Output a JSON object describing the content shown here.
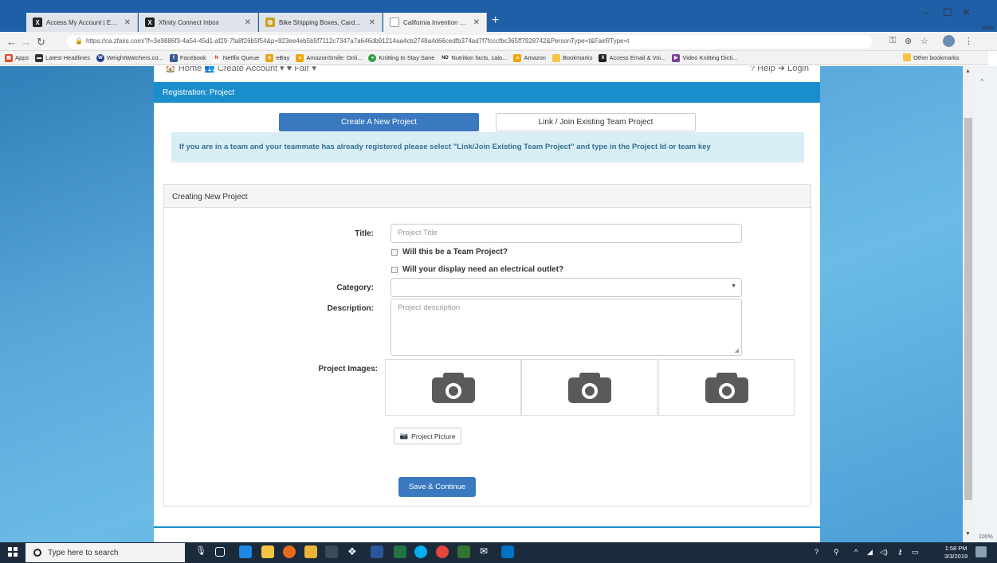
{
  "browser": {
    "tabs": [
      {
        "title": "Access My Account | Email | Onl",
        "favicon": "x-square-icon",
        "color": "#222"
      },
      {
        "title": "Xfinity Connect Inbox",
        "favicon": "x-square-icon",
        "color": "#222"
      },
      {
        "title": "Bike Shipping Boxes, Cardboard",
        "favicon": "bike-icon",
        "color": "#c9a227"
      },
      {
        "title": "California Invention Convention",
        "favicon": "page-icon",
        "color": "#999",
        "active": true
      }
    ],
    "new_tab": "+",
    "window_controls": {
      "minimize": "–",
      "maximize": "☐",
      "close": "✕"
    },
    "url": "https://ca.zfairs.com/?f=3e9886f3-4a54-45d1-af29-7fa8f26b5f54&p=923ee4eb5b5f7112c7347a7a646db91214aa4cb2748a4d66cedfb374ad7f7fcccfbc365ff7928742&PersonType=t&FairRType=t",
    "bookmarks": [
      {
        "label": "Apps",
        "color": "#e04b2a"
      },
      {
        "label": "Latest Headlines",
        "color": "#333"
      },
      {
        "label": "WeightWatchers.co...",
        "color": "#1e3c8a"
      },
      {
        "label": "Facebook",
        "color": "#3b5998"
      },
      {
        "label": "Netflix Queue",
        "color": "#d11"
      },
      {
        "label": "eBay",
        "color": "#e8a31b"
      },
      {
        "label": "AmazonSmile: Onli...",
        "color": "#f0a500"
      },
      {
        "label": "Knitting to Stay Sane",
        "color": "#2f9e44"
      },
      {
        "label": "Nutrition facts, calo...",
        "color": "#111"
      },
      {
        "label": "Amazon",
        "color": "#f0a500"
      },
      {
        "label": "Bookmarks",
        "color": "#f5c542"
      },
      {
        "label": "Access Email & Voi...",
        "color": "#222"
      },
      {
        "label": "Video Knitting Dicti...",
        "color": "#7a3fa0"
      }
    ],
    "other_bookmarks": "Other bookmarks",
    "zoom_pct": "100%",
    "side_text": "ents"
  },
  "site": {
    "top_nav_left": "🏠 Home   👥 Create Account ▾   ♥ Fair ▾",
    "top_nav_right": "? Help   ➜ Login",
    "reg_title": "Registration: Project",
    "create_btn": "Create A New Project",
    "link_btn": "Link / Join Existing Team Project",
    "info": "If you are in a team and your teammate has already registered please select \"Link/Join Existing Team Project\" and type in the Project Id or team key",
    "panel_title": "Creating New Project",
    "form": {
      "title_label": "Title:",
      "title_placeholder": "Project Title",
      "team_check": "Will this be a Team Project?",
      "outlet_check": "Will your display need an electrical outlet?",
      "category_label": "Category:",
      "category_value": "",
      "description_label": "Description:",
      "description_placeholder": "Project description",
      "images_label": "Project Images:",
      "picture_btn": "Project Picture",
      "save_btn": "Save & Continue"
    }
  },
  "taskbar": {
    "search_placeholder": "Type here to search",
    "time": "1:58 PM",
    "date": "3/3/2019"
  }
}
